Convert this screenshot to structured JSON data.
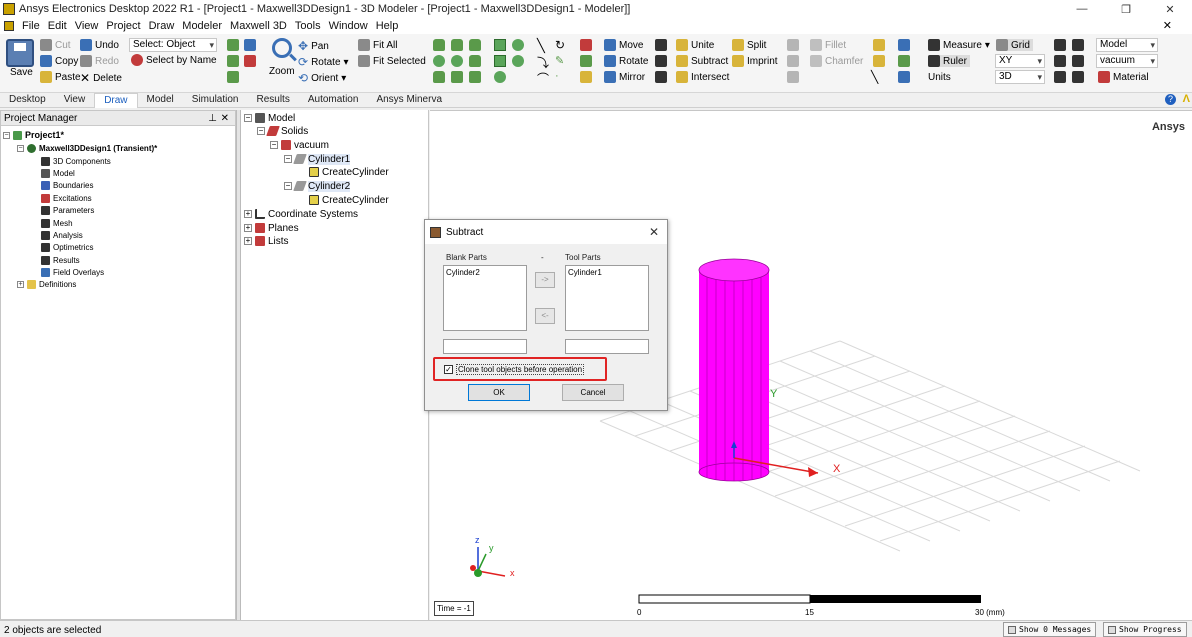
{
  "window": {
    "title": "Ansys Electronics Desktop 2022 R1 - [Project1 - Maxwell3DDesign1 - 3D Modeler - [Project1 - Maxwell3DDesign1 - Modeler]]",
    "minimize": "—",
    "restore": "❐",
    "close": "✕"
  },
  "menu": [
    "File",
    "Edit",
    "View",
    "Project",
    "Draw",
    "Modeler",
    "Maxwell 3D",
    "Tools",
    "Window",
    "Help"
  ],
  "ribbon": {
    "save": "Save",
    "cut": "Cut",
    "copy": "Copy",
    "paste": "Paste",
    "undo": "Undo",
    "redo": "Redo",
    "delete": "Delete",
    "select_combo": "Select: Object",
    "select_by_name": "Select by Name",
    "zoom": "Zoom",
    "pan": "Pan",
    "rotate": "Rotate",
    "orient": "Orient",
    "fit_all": "Fit All",
    "fit_selected": "Fit Selected",
    "move": "Move",
    "rotate2": "Rotate",
    "mirror": "Mirror",
    "unite": "Unite",
    "subtract": "Subtract",
    "intersect": "Intersect",
    "split": "Split",
    "imprint": "Imprint",
    "fillet": "Fillet",
    "chamfer": "Chamfer",
    "measure": "Measure",
    "ruler": "Ruler",
    "units": "Units",
    "grid": "Grid",
    "plane_combo": "XY",
    "dim_combo": "3D",
    "model_combo": "Model",
    "material_combo": "vacuum",
    "material": "Material"
  },
  "tabs": [
    "Desktop",
    "View",
    "Draw",
    "Model",
    "Simulation",
    "Results",
    "Automation",
    "Ansys Minerva"
  ],
  "active_tab": "Draw",
  "project_manager": {
    "header": "Project Manager",
    "pin": "⊥",
    "close": "✕",
    "project": "Project1*",
    "design": "Maxwell3DDesign1 (Transient)*",
    "items": [
      "3D Components",
      "Model",
      "Boundaries",
      "Excitations",
      "Parameters",
      "Mesh",
      "Analysis",
      "Optimetrics",
      "Results",
      "Field Overlays"
    ],
    "definitions": "Definitions"
  },
  "model_tree": {
    "model": "Model",
    "solids": "Solids",
    "vacuum": "vacuum",
    "cylinder1": "Cylinder1",
    "create1": "CreateCylinder",
    "cylinder2": "Cylinder2",
    "create2": "CreateCylinder",
    "coordinate_systems": "Coordinate Systems",
    "planes": "Planes",
    "lists": "Lists"
  },
  "viewport": {
    "brand": "Ansys",
    "time": "Time = -1",
    "axis_x": "X",
    "axis_y": "Y",
    "triad_x": "x",
    "triad_y": "y",
    "triad_z": "z",
    "scale_labels": [
      "0",
      "15",
      "30 (mm)"
    ],
    "cylinder_color": "#ff00ff"
  },
  "dialog": {
    "title": "Subtract",
    "close": "✕",
    "blank_parts_label": "Blank Parts",
    "dash": "-",
    "tool_parts_label": "Tool Parts",
    "blank_parts": [
      "Cylinder2"
    ],
    "tool_parts": [
      "Cylinder1"
    ],
    "to_right": "->",
    "to_left": "<-",
    "clone_label": "Clone tool objects before operation",
    "clone_checked": true,
    "ok": "OK",
    "cancel": "Cancel"
  },
  "status": {
    "text": "2 objects are selected",
    "show_messages": "Show 0 Messages",
    "show_progress": "Show Progress"
  }
}
